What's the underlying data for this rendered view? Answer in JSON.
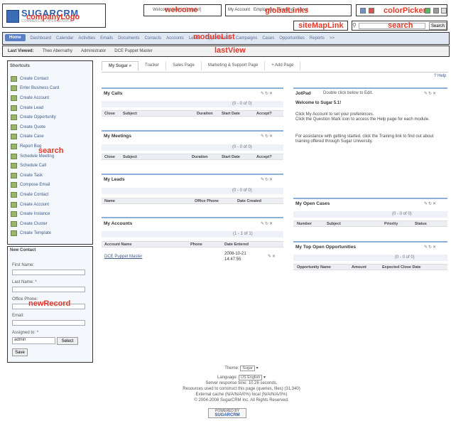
{
  "header": {
    "logo_text": "SUGARCRM",
    "logo_tagline": "COMMERCIAL OPEN SOURCE",
    "welcome_text": "Welcome, admin [Logout]",
    "global_links": [
      "My Account",
      "Employees",
      "Training",
      "About"
    ],
    "search_button": "Search",
    "search_placeholder": ""
  },
  "annotations": {
    "company_logo": "companyLogo",
    "welcome": "welcome",
    "global_links": "globalLinks",
    "color_picker": "colorPicker",
    "site_map_link": "siteMapLink",
    "search": "search",
    "module_list": "moduleList",
    "last_view": "lastView",
    "shortcuts_search": "search",
    "new_record": "newRecord"
  },
  "colors": {
    "swatches": [
      "#6d8fcc",
      "#d9534f",
      "#5cb85c",
      "#9a9a9a"
    ],
    "annotation": "#e23a2a",
    "accent": "#5b7fc4"
  },
  "module_tabs": [
    "Home",
    "Dashboard",
    "Calendar",
    "Activities",
    "Emails",
    "Documents",
    "Contacts",
    "Accounts",
    "Leads",
    "Opportunities",
    "Campaigns",
    "Cases",
    "Opportunities",
    "Reports",
    ">>"
  ],
  "last_viewed": {
    "label": "Last Viewed:",
    "items": [
      "Theo Abernathy",
      "Administrator",
      "DCE Puppet Master"
    ]
  },
  "shortcuts": {
    "title": "Shortcuts",
    "items": [
      "Create Contact",
      "Enter Business Card",
      "Create Account",
      "Create Lead",
      "Create Opportunity",
      "Create Quote",
      "Create Case",
      "Report Bug",
      "Schedule Meeting",
      "Schedule Call",
      "Create Task",
      "Compose Email",
      "Create Contact",
      "Create Account",
      "Create Instance",
      "Create Cluster",
      "Create Template"
    ]
  },
  "new_contact": {
    "title": "New Contact",
    "first_name": "First Name:",
    "last_name": "Last Name: *",
    "office_phone": "Office Phone:",
    "email": "Email:",
    "assigned_to": "Assigned to: *",
    "assigned_value": "admin",
    "select_button": "Select",
    "save_button": "Save"
  },
  "page_tabs": [
    "My Sugar »",
    "Tracker",
    "Sales Page",
    "Marketing & Support Page",
    "+ Add Page"
  ],
  "help_link": "? Help",
  "dashlets": {
    "calls": {
      "title": "My Calls",
      "pager": "(0 - 0 of 0)",
      "columns": [
        "Close",
        "Subject",
        "Duration",
        "Start Date",
        "Accept?"
      ]
    },
    "meetings": {
      "title": "My Meetings",
      "pager": "(0 - 0 of 0)",
      "columns": [
        "Close",
        "Subject",
        "Duration",
        "Start Date",
        "Accept?"
      ]
    },
    "leads": {
      "title": "My Leads",
      "pager": "(0 - 0 of 0)",
      "columns": [
        "Name",
        "Office Phone",
        "Date Created"
      ]
    },
    "accounts": {
      "title": "My Accounts",
      "pager": "(1 - 1 of 1)",
      "columns": [
        "Account Name",
        "Phone",
        "Date Entered"
      ],
      "row": {
        "name": "DCE Puppet Master",
        "date": "2008-10-21 14:47:55"
      }
    },
    "jotpad": {
      "title": "JotPad",
      "hint": "Double click below to Edit.",
      "welcome": "Welcome to Sugar 5.1!",
      "line1": "Click My Account to set your preferences.",
      "line2": "Click the Question Mark icon to access the Help page for each module.",
      "line3": "For assistance with getting started, click the Training link to find out about training offered through Sugar University."
    },
    "cases": {
      "title": "My Open Cases",
      "pager": "(0 - 0 of 0)",
      "columns": [
        "Number",
        "Subject",
        "Priority",
        "Status"
      ]
    },
    "opps": {
      "title": "My Top Open Opportunities",
      "pager": "(0 - 0 of 0)",
      "columns": [
        "Opportunity Name",
        "Amount",
        "Expected Close Date"
      ]
    }
  },
  "footer": {
    "theme_label": "Theme:",
    "theme_value": "Sugar",
    "language_label": "Language:",
    "language_value": "US English",
    "line1": "Server response time: 10.26 seconds.",
    "line2": "Resources used to construct this page (queries, files) (31,340)",
    "line3": "External cache (N/A/N/A/0%) local (N/A/N/A/0%)",
    "line4": "© 2004-2008 SugarCRM Inc. All Rights Reserved.",
    "powered_top": "POWERED BY",
    "powered_bottom": "SUGARCRM"
  }
}
